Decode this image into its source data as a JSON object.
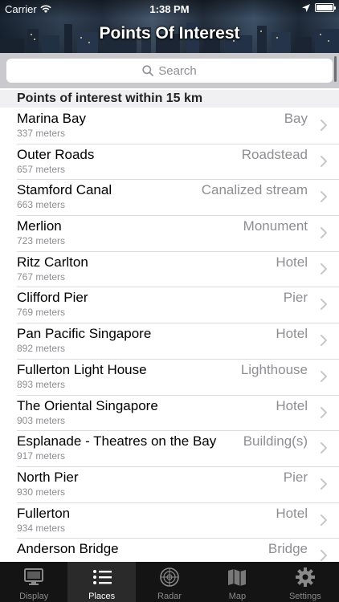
{
  "statusbar": {
    "carrier": "Carrier",
    "time": "1:38 PM",
    "battery_level": 1.0
  },
  "header": {
    "title": "Points Of Interest"
  },
  "search": {
    "placeholder": "Search"
  },
  "section": {
    "title": "Points of interest within 15 km"
  },
  "places": [
    {
      "name": "Marina Bay",
      "distance": "337 meters",
      "type": "Bay"
    },
    {
      "name": "Outer Roads",
      "distance": "657 meters",
      "type": "Roadstead"
    },
    {
      "name": "Stamford Canal",
      "distance": "663 meters",
      "type": "Canalized stream"
    },
    {
      "name": "Merlion",
      "distance": "723 meters",
      "type": "Monument"
    },
    {
      "name": "Ritz Carlton",
      "distance": "767 meters",
      "type": "Hotel"
    },
    {
      "name": "Clifford Pier",
      "distance": "769 meters",
      "type": "Pier"
    },
    {
      "name": "Pan Pacific Singapore",
      "distance": "892 meters",
      "type": "Hotel"
    },
    {
      "name": "Fullerton Light House",
      "distance": "893 meters",
      "type": "Lighthouse"
    },
    {
      "name": "The Oriental Singapore",
      "distance": "903 meters",
      "type": "Hotel"
    },
    {
      "name": "Esplanade - Theatres on the Bay",
      "distance": "917 meters",
      "type": "Building(s)"
    },
    {
      "name": "North Pier",
      "distance": "930 meters",
      "type": "Pier"
    },
    {
      "name": "Fullerton",
      "distance": "934 meters",
      "type": "Hotel"
    },
    {
      "name": "Anderson Bridge",
      "distance": "",
      "type": "Bridge"
    }
  ],
  "tabbar": {
    "tabs": [
      {
        "label": "Display",
        "icon": "display-icon",
        "active": false
      },
      {
        "label": "Places",
        "icon": "list-icon",
        "active": true
      },
      {
        "label": "Radar",
        "icon": "radar-icon",
        "active": false
      },
      {
        "label": "Map",
        "icon": "map-icon",
        "active": false
      },
      {
        "label": "Settings",
        "icon": "gear-icon",
        "active": false
      }
    ]
  },
  "colors": {
    "accent_text": "#8e8e93",
    "tabbar_bg": "#141414"
  }
}
